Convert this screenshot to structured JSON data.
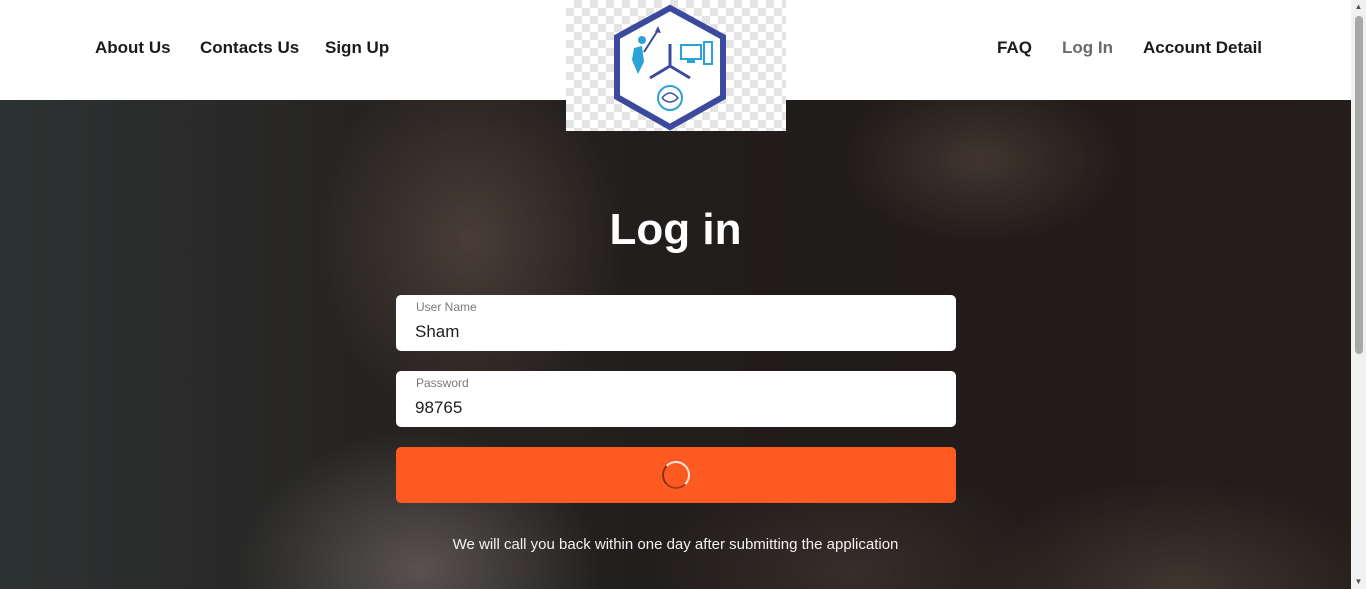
{
  "nav": {
    "left": [
      {
        "label": "About Us"
      },
      {
        "label": "Contacts Us"
      },
      {
        "label": "Sign Up"
      }
    ],
    "right": [
      {
        "label": "FAQ"
      },
      {
        "label": "Log In"
      },
      {
        "label": "Account Detail"
      }
    ]
  },
  "logo": {
    "icon": "hexagon-tech-logo",
    "colors": {
      "frame": "#3b4a9c",
      "accent": "#2aa3d8"
    }
  },
  "login": {
    "title": "Log in",
    "username": {
      "label": "User Name",
      "value": "Sham"
    },
    "password": {
      "label": "Password",
      "value": "98765"
    },
    "submit": {
      "state": "loading",
      "icon": "spinner-icon",
      "color": "#ff5a22"
    },
    "note": "We will call you back within one day after submitting the application"
  }
}
